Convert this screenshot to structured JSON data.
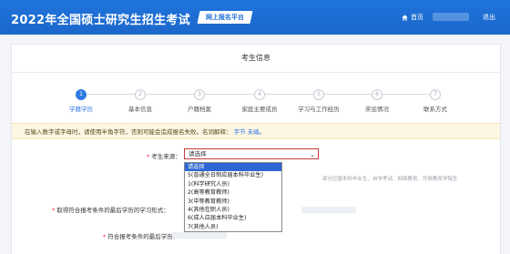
{
  "header": {
    "title": "2022年全国硕士研究生招生考试",
    "badge": "网上报名平台",
    "home_label": "首页",
    "logout_label": "退出"
  },
  "panel": {
    "title": "考生信息"
  },
  "steps": [
    {
      "num": "1",
      "label": "学籍学历",
      "active": true
    },
    {
      "num": "2",
      "label": "基本信息"
    },
    {
      "num": "3",
      "label": "户籍档案"
    },
    {
      "num": "4",
      "label": "家庭主要成员"
    },
    {
      "num": "5",
      "label": "学习与工作经历"
    },
    {
      "num": "6",
      "label": "奖惩情况"
    },
    {
      "num": "7",
      "label": "联系方式"
    }
  ],
  "notice": {
    "text": "在输入数字或字母时，请使用半角字符，否则可能会造成报名失败。名词解释：",
    "link1": "字节",
    "link2": "未编。"
  },
  "form": {
    "source_label": "考生来源：",
    "source_value": "请选择",
    "qualify_label": "取得符合报考条件的最后学历的学习形式：",
    "degree_label": "符合报考条件的最后学历："
  },
  "dropdown_options": [
    "请选择",
    "5(普通全日制应届本科毕业生)",
    "1(科学研究人员)",
    "2(高等教育教师)",
    "3(中等教育教师)",
    "4(其他在职人员)",
    "6(成人应届本科毕业生)",
    "7(其他人员)"
  ],
  "hint": "部分应届本科毕业生、自学考试、网络教育、开放教育学院生",
  "colors": {
    "header_bg": "#1d6fd6",
    "active_step": "#2e7be4",
    "notice_bg": "#fdf6e3"
  }
}
